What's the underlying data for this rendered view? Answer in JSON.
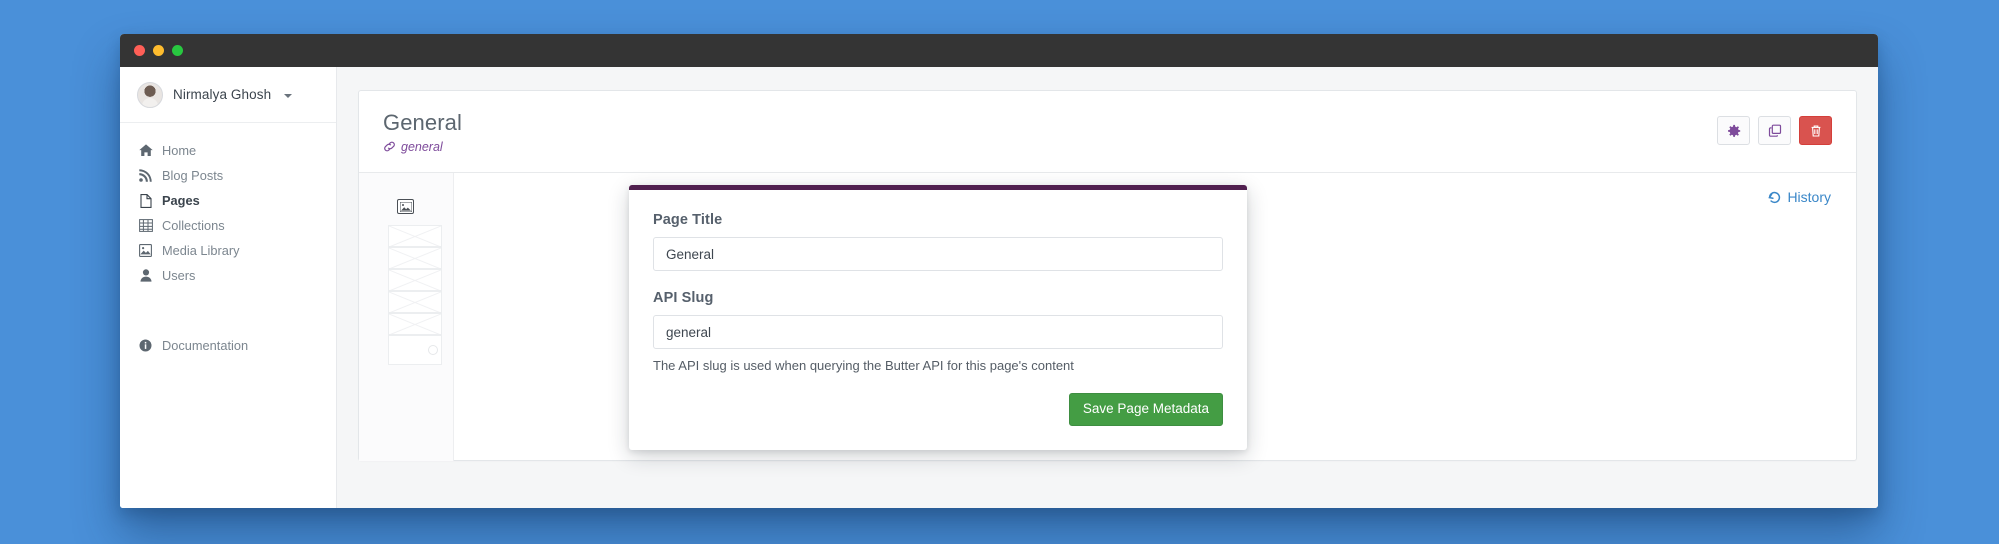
{
  "window": {
    "traffic_lights": [
      "close",
      "minimize",
      "maximize"
    ]
  },
  "sidebar": {
    "user": {
      "name": "Nirmalya Ghosh",
      "avatar_icon": "user-avatar",
      "caret_icon": "chevron-down-icon"
    },
    "items": [
      {
        "label": "Home",
        "icon": "home-icon",
        "active": false
      },
      {
        "label": "Blog Posts",
        "icon": "rss-icon",
        "active": false
      },
      {
        "label": "Pages",
        "icon": "file-icon",
        "active": true
      },
      {
        "label": "Collections",
        "icon": "table-icon",
        "active": false
      },
      {
        "label": "Media Library",
        "icon": "image-icon",
        "active": false
      },
      {
        "label": "Users",
        "icon": "user-icon",
        "active": false
      }
    ],
    "footer_items": [
      {
        "label": "Documentation",
        "icon": "info-circle-icon"
      }
    ]
  },
  "header": {
    "title": "General",
    "slug": "general",
    "slug_icon": "link-icon",
    "actions": [
      {
        "name": "settings",
        "icon": "gear-icon",
        "style": "default"
      },
      {
        "name": "duplicate",
        "icon": "copy-icon",
        "style": "default"
      },
      {
        "name": "delete",
        "icon": "trash-icon",
        "style": "danger"
      }
    ]
  },
  "body": {
    "history_label": "History",
    "history_icon": "history-icon",
    "rail_thumb_icon": "image-placeholder-icon"
  },
  "modal": {
    "accent_color": "#51204f",
    "page_title": {
      "label": "Page Title",
      "value": "General",
      "placeholder": "Page Title"
    },
    "api_slug": {
      "label": "API Slug",
      "value": "general",
      "placeholder": "API Slug",
      "help": "The API slug is used when querying the Butter API for this page's content"
    },
    "save_label": "Save Page Metadata"
  },
  "colors": {
    "desktop": "#4a90d9",
    "titlebar": "#343434",
    "accent_purple": "#7e4b9b",
    "modal_accent": "#51204f",
    "link_blue": "#3a87c8",
    "save_green": "#449d44",
    "danger_red": "#d9534f"
  }
}
